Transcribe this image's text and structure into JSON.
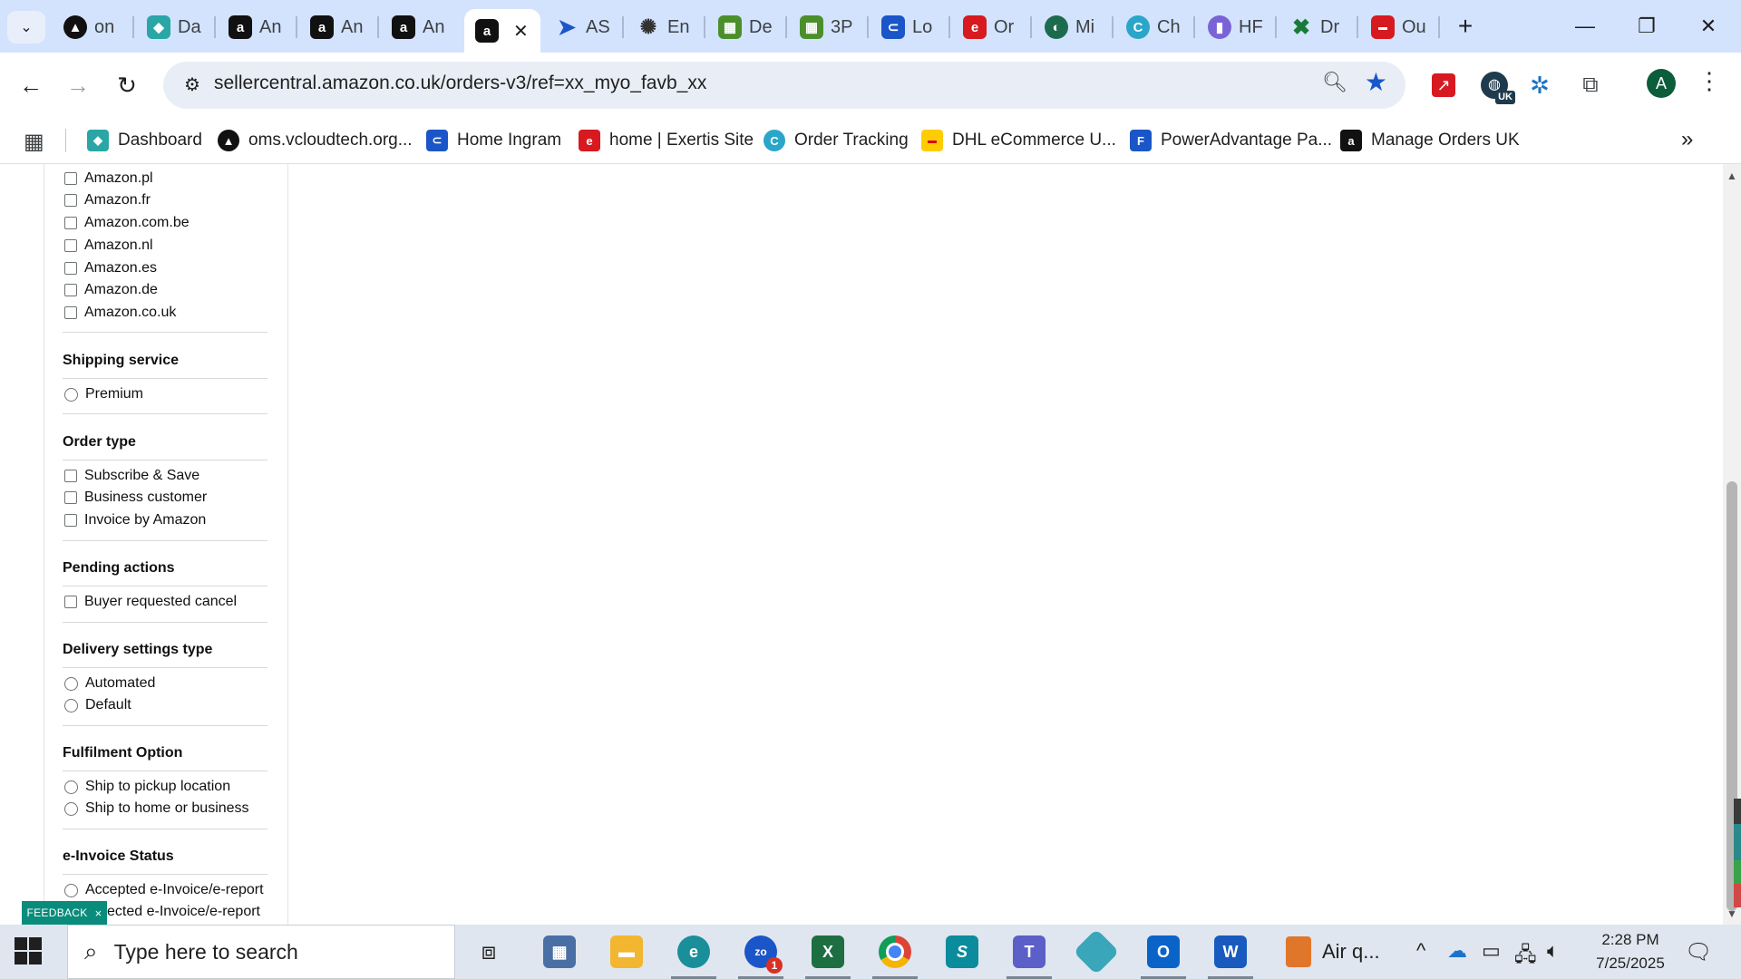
{
  "browser": {
    "tabs": [
      {
        "title": "on",
        "icon": "vcloud-a-icon",
        "color": "#111111"
      },
      {
        "title": "Da",
        "icon": "cube-icon",
        "color": "#2aa6a6"
      },
      {
        "title": "An",
        "icon": "amazon-a-icon",
        "color": "#111111"
      },
      {
        "title": "An",
        "icon": "amazon-a-icon",
        "color": "#111111"
      },
      {
        "title": "An",
        "icon": "amazon-a-icon",
        "color": "#111111"
      },
      {
        "title": "",
        "icon": "amazon-a-icon",
        "color": "#111111",
        "active": true
      },
      {
        "title": "AS",
        "icon": "arrow-logo-icon",
        "color": "#1a56c8"
      },
      {
        "title": "En",
        "icon": "openai-icon",
        "color": "#333333"
      },
      {
        "title": "De",
        "icon": "store-icon",
        "color": "#4b8f2b"
      },
      {
        "title": "3P",
        "icon": "store-icon",
        "color": "#4b8f2b"
      },
      {
        "title": "Lo",
        "icon": "ingram-icon",
        "color": "#1a56c8"
      },
      {
        "title": "Or",
        "icon": "exertis-icon",
        "color": "#d71920"
      },
      {
        "title": "Mi",
        "icon": "leaf-icon",
        "color": "#1d6b4f"
      },
      {
        "title": "Ch",
        "icon": "tracking-c-icon",
        "color": "#2aa6c9"
      },
      {
        "title": "HF",
        "icon": "chart-icon",
        "color": "#7a63d6"
      },
      {
        "title": "Dr",
        "icon": "x-logo-icon",
        "color": "#1a7a3a"
      },
      {
        "title": "Ou",
        "icon": "shop-logo-icon",
        "color": "#d71920"
      }
    ],
    "active_tab_close": "✕",
    "new_tab": "+",
    "window_controls": {
      "minimize": "—",
      "restore": "❐",
      "close": "✕"
    },
    "address": "sellercentral.amazon.co.uk/orders-v3/ref=xx_myo_favb_xx",
    "profile_initial": "A",
    "extension_badge": "UK",
    "bookmarks": [
      {
        "label": "Dashboard",
        "icon": "cube-icon",
        "color": "#2aa6a6"
      },
      {
        "label": "oms.vcloudtech.org...",
        "icon": "vcloud-a-icon",
        "color": "#111111"
      },
      {
        "label": "Home Ingram",
        "icon": "ingram-icon",
        "color": "#1a56c8"
      },
      {
        "label": "home | Exertis Site",
        "icon": "exertis-icon",
        "color": "#d71920"
      },
      {
        "label": "Order Tracking",
        "icon": "tracking-c-icon",
        "color": "#2aa6c9"
      },
      {
        "label": "DHL eCommerce U...",
        "icon": "dhl-icon",
        "color": "#ffcc00"
      },
      {
        "label": "PowerAdvantage Pa...",
        "icon": "poweradvantage-icon",
        "color": "#1a56c8"
      },
      {
        "label": "Manage Orders UK",
        "icon": "amazon-a-icon",
        "color": "#111111"
      }
    ]
  },
  "sidebar": {
    "marketplaces": [
      "Amazon.pl",
      "Amazon.fr",
      "Amazon.com.be",
      "Amazon.nl",
      "Amazon.es",
      "Amazon.de",
      "Amazon.co.uk"
    ],
    "shipping_service": {
      "title": "Shipping service",
      "options": [
        "Premium"
      ]
    },
    "order_type": {
      "title": "Order type",
      "options": [
        "Subscribe & Save",
        "Business customer",
        "Invoice by Amazon"
      ]
    },
    "pending_actions": {
      "title": "Pending actions",
      "options": [
        "Buyer requested cancel"
      ]
    },
    "delivery_settings": {
      "title": "Delivery settings type",
      "options": [
        "Automated",
        "Default"
      ]
    },
    "fulfilment": {
      "title": "Fulfilment Option",
      "options": [
        "Ship to pickup location",
        "Ship to home or business"
      ]
    },
    "einvoice": {
      "title": "e-Invoice Status",
      "options": [
        "Accepted e-Invoice/e-report",
        "Rejected e-Invoice/e-report"
      ]
    }
  },
  "feedback": {
    "label": "FEEDBACK",
    "close": "×"
  },
  "taskbar": {
    "search_placeholder": "Type here to search",
    "weather": "Air q...",
    "time": "2:28 PM",
    "date": "7/25/2025",
    "zoom_badge": "1"
  }
}
